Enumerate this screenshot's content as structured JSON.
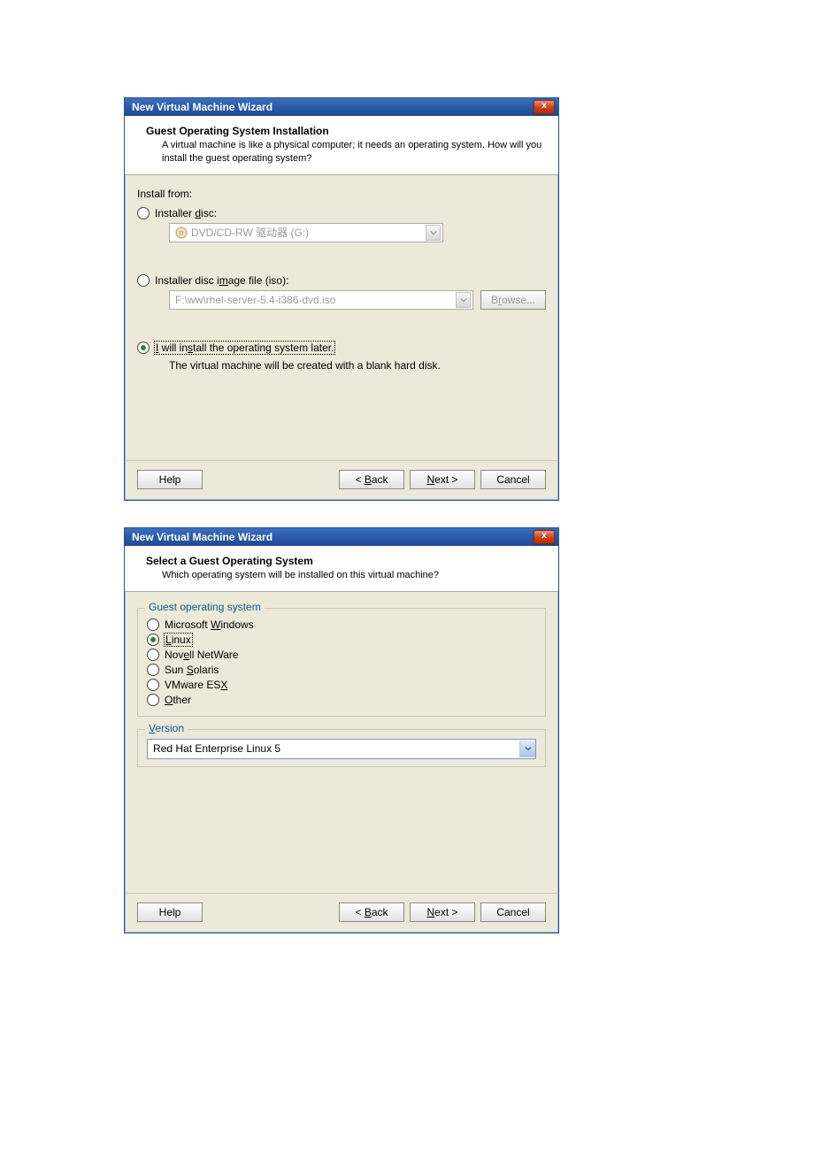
{
  "dialog1": {
    "title": "New Virtual Machine Wizard",
    "close_symbol": "x",
    "heading": "Guest Operating System Installation",
    "subtext": "A virtual machine is like a physical computer; it needs an operating system. How will you install the guest operating system?",
    "install_from_label": "Install from:",
    "option_disc_prefix": "Installer ",
    "option_disc_u": "d",
    "option_disc_suffix": "isc:",
    "disc_dropdown": "DVD/CD-RW 驱动器 (G:)",
    "option_iso_prefix": "Installer disc i",
    "option_iso_u": "m",
    "option_iso_suffix": "age file (iso):",
    "iso_path": "F:\\ww\\rhel-server-5.4-i386-dvd.iso",
    "browse_prefix": "B",
    "browse_u": "r",
    "browse_suffix": "owse...",
    "option_later_u": "I",
    "option_later_mid1": " will in",
    "option_later_u2": "s",
    "option_later_mid2": "tall the operating system later.",
    "later_note": "The virtual machine will be created with a blank hard disk.",
    "help": "Help",
    "back_prefix": "< ",
    "back_u": "B",
    "back_suffix": "ack",
    "next_u": "N",
    "next_suffix": "ext >",
    "cancel": "Cancel"
  },
  "dialog2": {
    "title": "New Virtual Machine Wizard",
    "close_symbol": "x",
    "heading": "Select a Guest Operating System",
    "subtext": "Which operating system will be installed on this virtual machine?",
    "group_label": "Guest operating system",
    "os": {
      "win_prefix": "Microsoft ",
      "win_u": "W",
      "win_suffix": "indows",
      "linux_u": "L",
      "linux_suffix": "inux",
      "novell_prefix": "Nov",
      "novell_u": "e",
      "novell_suffix": "ll NetWare",
      "sun_prefix": "Sun ",
      "sun_u": "S",
      "sun_suffix": "olaris",
      "vmware_prefix": "VMware ES",
      "vmware_u": "X",
      "other_u": "O",
      "other_suffix": "ther"
    },
    "version_label_u": "V",
    "version_label_suffix": "ersion",
    "version_value": "Red Hat Enterprise Linux 5",
    "help": "Help",
    "back_prefix": "< ",
    "back_u": "B",
    "back_suffix": "ack",
    "next_u": "N",
    "next_suffix": "ext >",
    "cancel": "Cancel"
  }
}
